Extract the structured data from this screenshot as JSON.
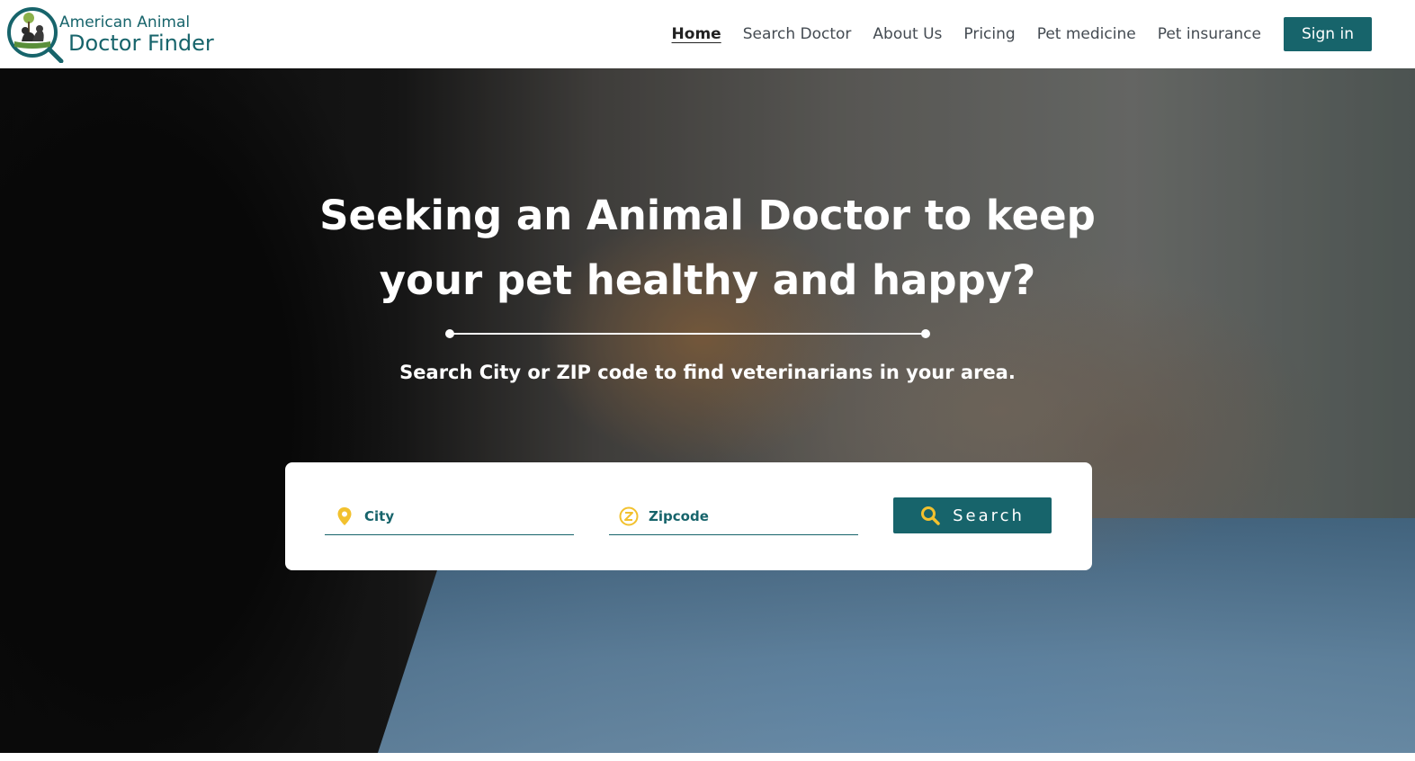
{
  "brand": {
    "line1": "American Animal",
    "line2": "Doctor Finder"
  },
  "nav": {
    "items": [
      {
        "label": "Home",
        "active": true
      },
      {
        "label": "Search Doctor",
        "active": false
      },
      {
        "label": "About Us",
        "active": false
      },
      {
        "label": "Pricing",
        "active": false
      },
      {
        "label": "Pet medicine",
        "active": false
      },
      {
        "label": "Pet insurance",
        "active": false
      }
    ],
    "signin_label": "Sign in"
  },
  "hero": {
    "title_line1": "Seeking an Animal Doctor to keep",
    "title_line2": "your pet healthy and happy?",
    "subtitle": "Search City or ZIP code to find veterinarians in your area."
  },
  "search": {
    "city_placeholder": "City",
    "city_value": "",
    "zip_placeholder": "Zipcode",
    "zip_value": "",
    "button_label": "Search",
    "icons": {
      "city": "map-pin-icon",
      "zip": "zipcode-icon",
      "button": "search-icon"
    }
  },
  "colors": {
    "brand_teal": "#17646b",
    "accent_yellow": "#f2c12e",
    "text_dark": "#444b52"
  }
}
